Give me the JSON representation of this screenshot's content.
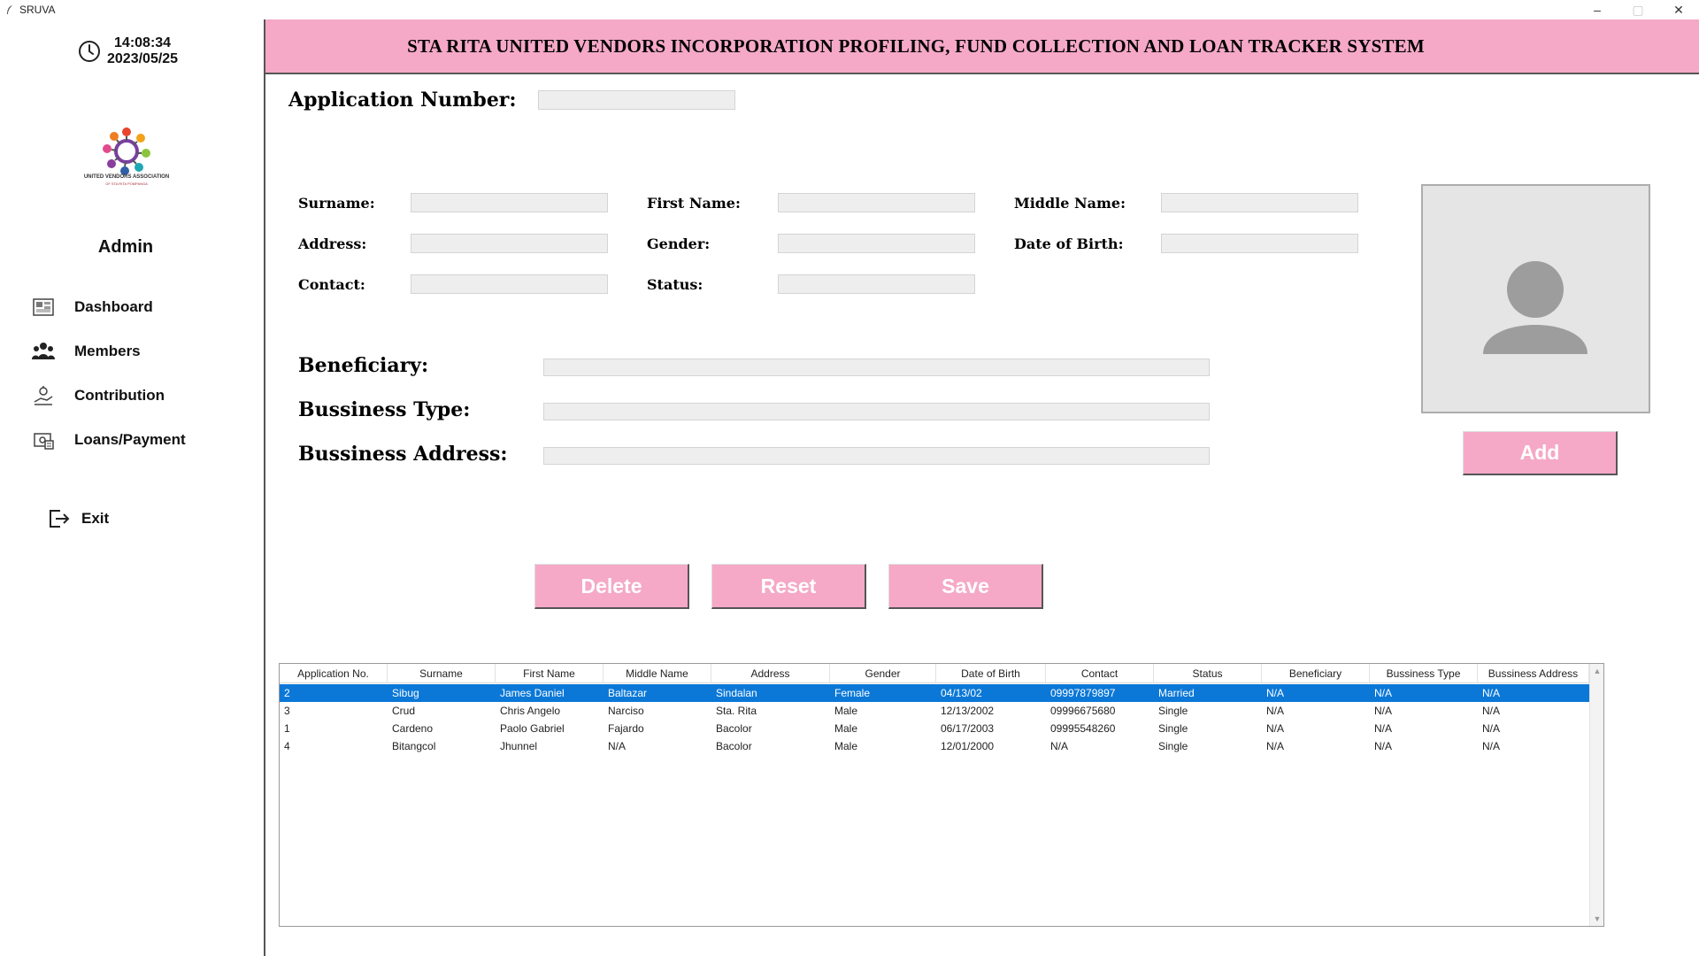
{
  "window": {
    "title": "SRUVA",
    "controls": [
      "–",
      "▢",
      "✕"
    ]
  },
  "sidebar": {
    "time": "14:08:34",
    "date": "2023/05/25",
    "logo_text": "UNITED VENDORS ASSOCIATION",
    "logo_subtext": "OF STA RITA POMPANGA",
    "role": "Admin",
    "items": [
      {
        "label": "Dashboard",
        "icon": "dashboard-icon"
      },
      {
        "label": "Members",
        "icon": "members-icon"
      },
      {
        "label": "Contribution",
        "icon": "contribution-icon"
      },
      {
        "label": "Loans/Payment",
        "icon": "loans-icon"
      }
    ],
    "exit_label": "Exit"
  },
  "header": {
    "title": "STA RITA UNITED VENDORS INCORPORATION PROFILING, FUND COLLECTION AND LOAN TRACKER SYSTEM"
  },
  "form": {
    "application_number_label": "Application Number:",
    "application_number_value": "",
    "surname_label": "Surname:",
    "surname_value": "",
    "first_name_label": "First Name:",
    "first_name_value": "",
    "middle_name_label": "Middle Name:",
    "middle_name_value": "",
    "address_label": "Address:",
    "address_value": "",
    "gender_label": "Gender:",
    "gender_value": "",
    "dob_label": "Date of Birth:",
    "dob_value": "",
    "contact_label": "Contact:",
    "contact_value": "",
    "status_label": "Status:",
    "status_value": "",
    "beneficiary_label": "Beneficiary:",
    "beneficiary_value": "",
    "business_type_label": "Bussiness Type:",
    "business_type_value": "",
    "business_address_label": "Bussiness Address:",
    "business_address_value": ""
  },
  "buttons": {
    "add": "Add",
    "delete": "Delete",
    "reset": "Reset",
    "save": "Save"
  },
  "table": {
    "columns": [
      "Application No.",
      "Surname",
      "First Name",
      "Middle Name",
      "Address",
      "Gender",
      "Date of Birth",
      "Contact",
      "Status",
      "Beneficiary",
      "Bussiness Type",
      "Bussiness Address"
    ],
    "rows": [
      [
        "2",
        "Sibug",
        "James Daniel",
        "Baltazar",
        "Sindalan",
        "Female",
        "04/13/02",
        "09997879897",
        "Married",
        "N/A",
        "N/A",
        "N/A"
      ],
      [
        "3",
        "Crud",
        "Chris Angelo",
        "Narciso",
        "Sta. Rita",
        "Male",
        "12/13/2002",
        "09996675680",
        "Single",
        "N/A",
        "N/A",
        "N/A"
      ],
      [
        "1",
        "Cardeno",
        "Paolo Gabriel",
        "Fajardo",
        "Bacolor",
        "Male",
        "06/17/2003",
        "09995548260",
        "Single",
        "N/A",
        "N/A",
        "N/A"
      ],
      [
        "4",
        "Bitangcol",
        "Jhunnel",
        "N/A",
        "Bacolor",
        "Male",
        "12/01/2000",
        "N/A",
        "Single",
        "N/A",
        "N/A",
        "N/A"
      ]
    ],
    "selected_row": 0
  },
  "colors": {
    "accent_pink": "#f5a9c6",
    "selection_blue": "#0b78d7"
  }
}
